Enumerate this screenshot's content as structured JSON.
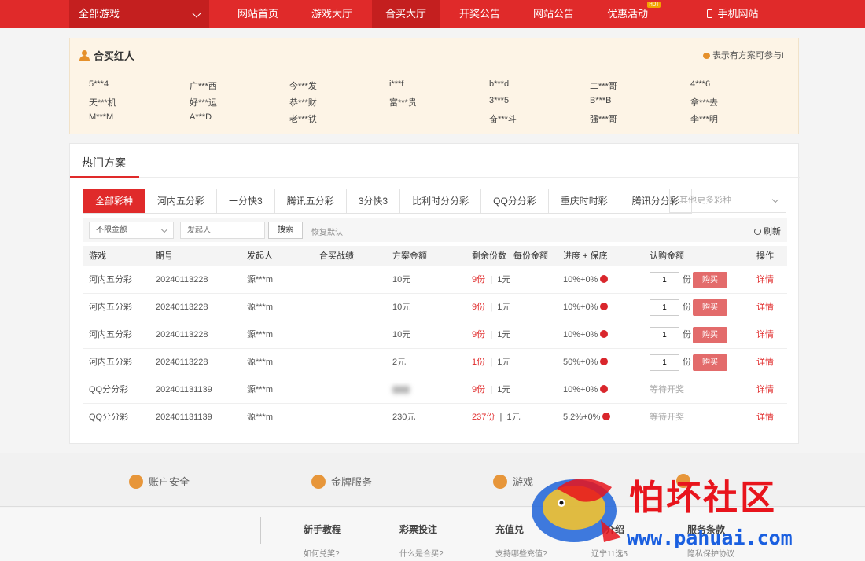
{
  "nav": {
    "all_games": "全部游戏",
    "items": [
      "网站首页",
      "游戏大厅",
      "合买大厅",
      "开奖公告",
      "网站公告",
      "优惠活动"
    ],
    "hot_badge": "HOT",
    "mobile": "手机网站"
  },
  "hero": {
    "title": "合买红人",
    "note": "表示有方案可参与!",
    "winners": [
      [
        "5***4",
        "广***西",
        "今***发",
        "i***f",
        "b***d",
        "二***哥",
        "4***6"
      ],
      [
        "天***机",
        "好***运",
        "恭***财",
        "富***贵",
        "3***5",
        "B***B",
        "拿***去"
      ],
      [
        "M***M",
        "A***D",
        "老***铁",
        "",
        "奋***斗",
        "强***哥",
        "李***明"
      ]
    ]
  },
  "plans": {
    "title": "热门方案",
    "tabs": [
      "全部彩种",
      "河内五分彩",
      "一分快3",
      "腾讯五分彩",
      "3分快3",
      "比利时分分彩",
      "QQ分分彩",
      "重庆时时彩",
      "腾讯分分彩"
    ],
    "more_placeholder": "其他更多彩种",
    "filter": {
      "amount": "不限金额",
      "initiator_placeholder": "发起人",
      "search": "搜索",
      "reset": "恢复默认",
      "refresh": "刷新"
    },
    "columns": [
      "游戏",
      "期号",
      "发起人",
      "合买战绩",
      "方案金额",
      "剩余份数 | 每份金额",
      "进度 + 保底",
      "认购金额",
      "操作"
    ],
    "rows": [
      {
        "game": "河内五分彩",
        "issue": "20240113228",
        "initiator": "源***m",
        "amount": "10元",
        "remain": "9份",
        "per": "1元",
        "progress": "10%+0%",
        "qty": "1",
        "unit": "份",
        "buy": "购买",
        "detail": "详情"
      },
      {
        "game": "河内五分彩",
        "issue": "20240113228",
        "initiator": "源***m",
        "amount": "10元",
        "remain": "9份",
        "per": "1元",
        "progress": "10%+0%",
        "qty": "1",
        "unit": "份",
        "buy": "购买",
        "detail": "详情"
      },
      {
        "game": "河内五分彩",
        "issue": "20240113228",
        "initiator": "源***m",
        "amount": "10元",
        "remain": "9份",
        "per": "1元",
        "progress": "10%+0%",
        "qty": "1",
        "unit": "份",
        "buy": "购买",
        "detail": "详情"
      },
      {
        "game": "河内五分彩",
        "issue": "20240113228",
        "initiator": "源***m",
        "amount": "2元",
        "remain": "1份",
        "per": "1元",
        "progress": "50%+0%",
        "qty": "1",
        "unit": "份",
        "buy": "购买",
        "detail": "详情"
      },
      {
        "game": "QQ分分彩",
        "issue": "202401131139",
        "initiator": "源***m",
        "amount": "",
        "remain": "9份",
        "per": "1元",
        "progress": "10%+0%",
        "wait": "等待开奖",
        "detail": "详情"
      },
      {
        "game": "QQ分分彩",
        "issue": "202401131139",
        "initiator": "源***m",
        "amount": "230元",
        "remain": "237份",
        "per": "1元",
        "progress": "5.2%+0%",
        "wait": "等待开奖",
        "detail": "详情"
      }
    ]
  },
  "footer": {
    "features": [
      "账户安全",
      "金牌服务",
      "游戏",
      ""
    ],
    "columns": [
      {
        "title": "新手教程",
        "link": "如何兑奖?"
      },
      {
        "title": "彩票投注",
        "link": "什么是合买?"
      },
      {
        "title": "充值兑",
        "link": "支持哪些充值?"
      },
      {
        "title": "介绍",
        "link": "辽宁11选5"
      },
      {
        "title": "服务条款",
        "link": "隐私保护协议"
      }
    ]
  },
  "watermark": {
    "text": "怕坏社区",
    "url": "www.pahuai.com"
  }
}
